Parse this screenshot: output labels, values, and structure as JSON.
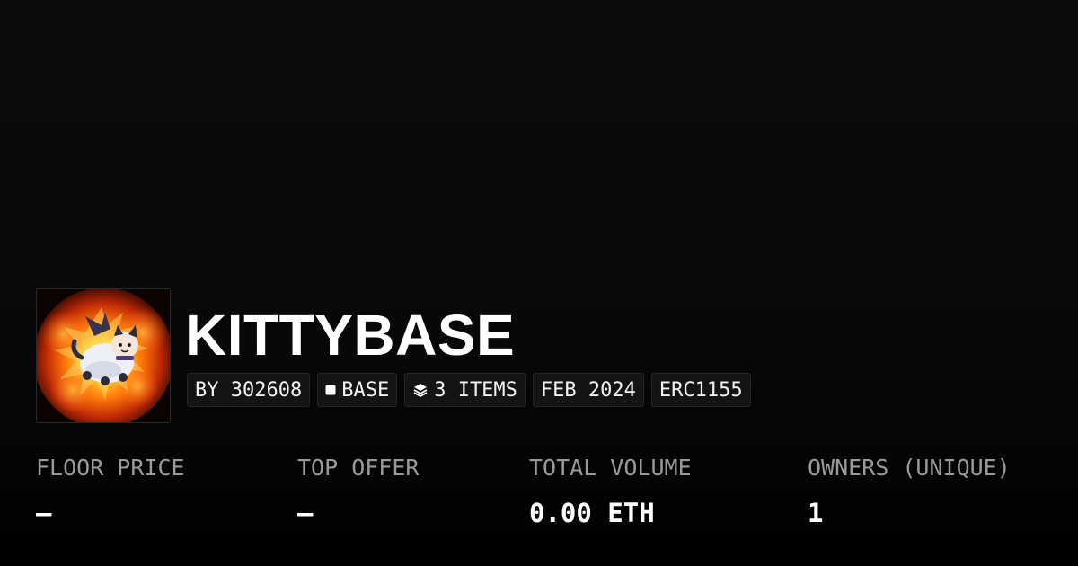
{
  "collection": {
    "name": "KITTYBASE",
    "avatar_icon": "flying-cat-explosion-image"
  },
  "chips": {
    "creator": "BY 302608",
    "chain": "BASE",
    "chain_icon": "square-icon",
    "items": "3 ITEMS",
    "items_icon": "layers-icon",
    "date": "FEB 2024",
    "standard": "ERC1155"
  },
  "stats": {
    "floor_price": {
      "label": "FLOOR PRICE",
      "value": "–"
    },
    "top_offer": {
      "label": "TOP OFFER",
      "value": "–"
    },
    "total_volume": {
      "label": "TOTAL VOLUME",
      "value": "0.00 ETH"
    },
    "owners": {
      "label": "OWNERS (UNIQUE)",
      "value": "1"
    }
  },
  "colors": {
    "background": "#0a0a0a",
    "text_primary": "#ffffff",
    "text_muted": "#9a9a9a",
    "chip_background": "#141414"
  }
}
